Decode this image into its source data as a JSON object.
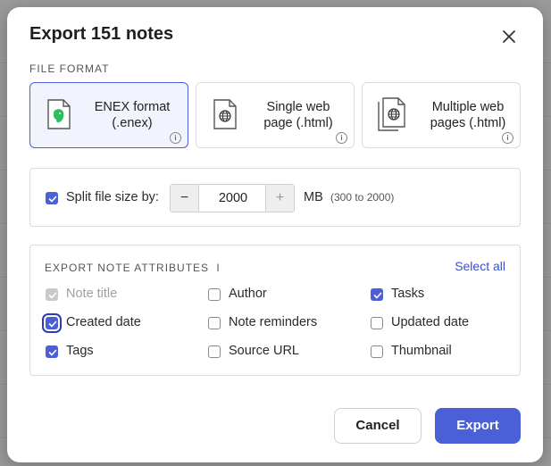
{
  "dialog": {
    "title": "Export 151 notes",
    "close_icon": "close-icon"
  },
  "file_format": {
    "section_label": "FILE FORMAT",
    "options": [
      {
        "label_line1": "ENEX format",
        "label_line2": "(.enex)",
        "icon": "evernote-doc-icon",
        "selected": true
      },
      {
        "label_line1": "Single web",
        "label_line2": "page (.html)",
        "icon": "globe-doc-icon",
        "selected": false
      },
      {
        "label_line1": "Multiple web",
        "label_line2": "pages (.html)",
        "icon": "stacked-globe-doc-icon",
        "selected": false
      }
    ]
  },
  "split": {
    "checked": true,
    "label": "Split file size by:",
    "minus": "−",
    "value": "2000",
    "plus": "+",
    "unit": "MB",
    "range_hint": "(300 to 2000)"
  },
  "attributes": {
    "section_label": "EXPORT NOTE ATTRIBUTES",
    "select_all": "Select all",
    "items": [
      {
        "label": "Note title",
        "checked": true,
        "disabled": true
      },
      {
        "label": "Author",
        "checked": false
      },
      {
        "label": "Tasks",
        "checked": true
      },
      {
        "label": "Created date",
        "checked": true,
        "focused": true
      },
      {
        "label": "Note reminders",
        "checked": false
      },
      {
        "label": "Updated date",
        "checked": false
      },
      {
        "label": "Tags",
        "checked": true
      },
      {
        "label": "Source URL",
        "checked": false
      },
      {
        "label": "Thumbnail",
        "checked": false
      }
    ]
  },
  "actions": {
    "cancel": "Cancel",
    "export": "Export"
  },
  "colors": {
    "accent": "#4b5fd6",
    "evernote_green": "#2dbe60"
  }
}
